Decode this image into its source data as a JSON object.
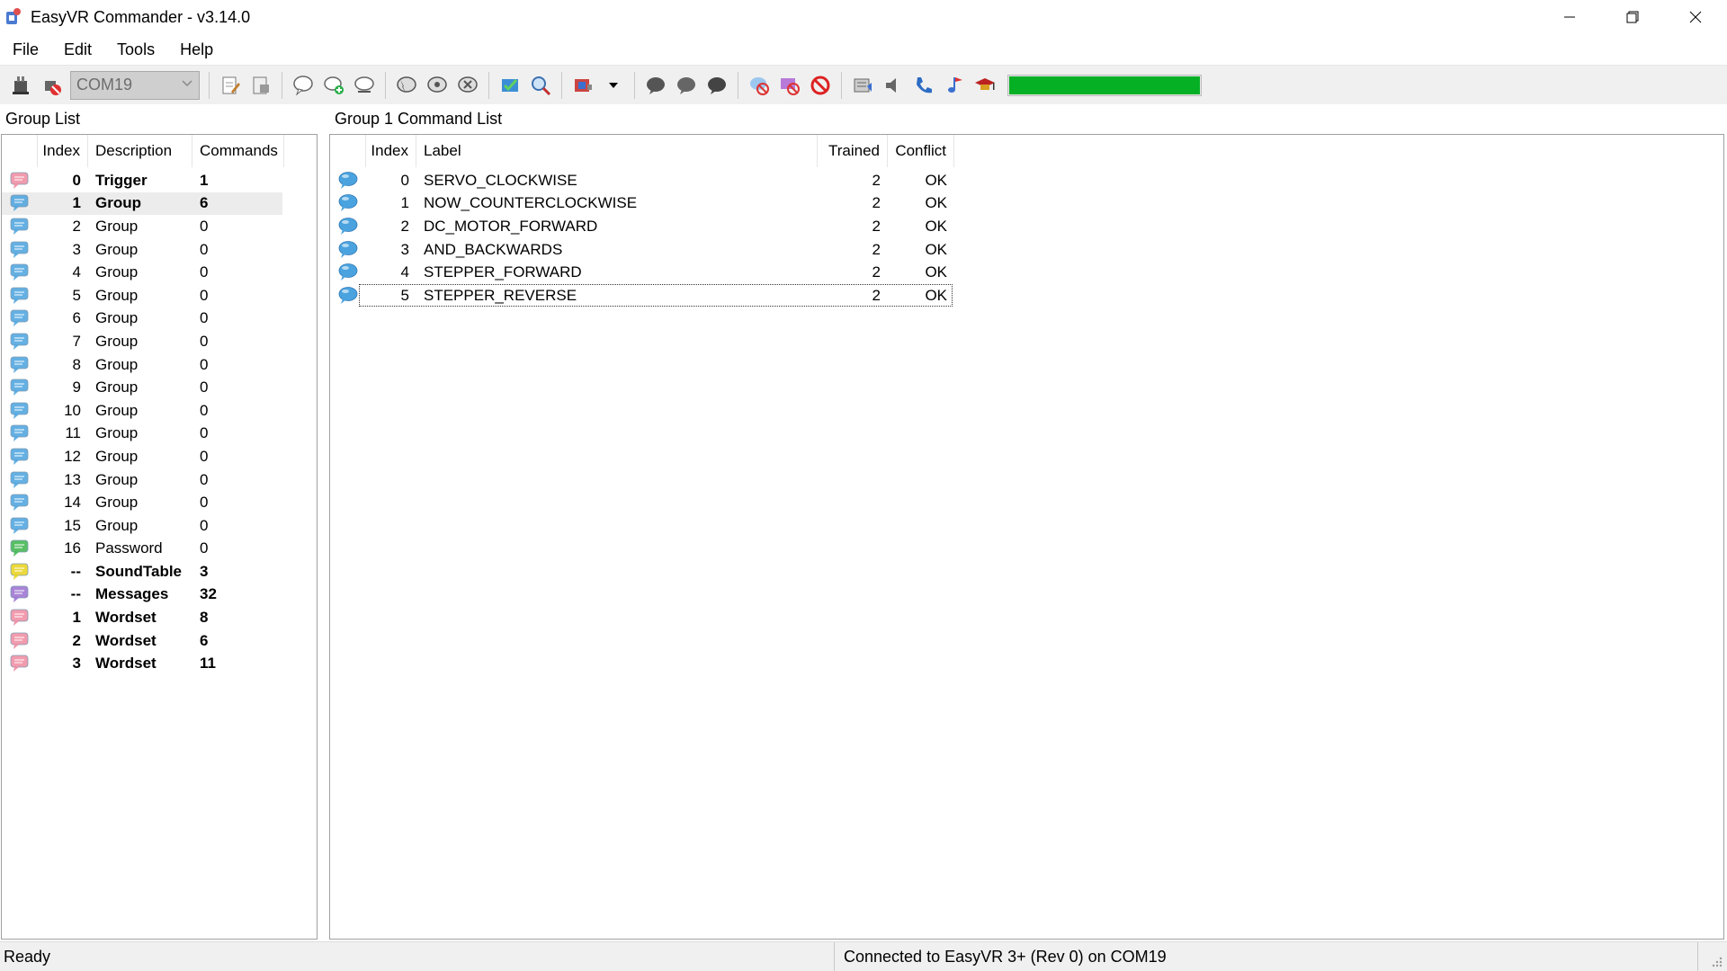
{
  "window": {
    "title": "EasyVR Commander - v3.14.0"
  },
  "menu": {
    "items": [
      "File",
      "Edit",
      "Tools",
      "Help"
    ]
  },
  "toolbar": {
    "port_value": "COM19",
    "progress": 1.0,
    "progress_color": "#06b025"
  },
  "group_panel": {
    "title": "Group List",
    "headers": {
      "index": "Index",
      "description": "Description",
      "commands": "Commands"
    },
    "rows": [
      {
        "icon": "speech-bubble-pink",
        "index": "0",
        "description": "Trigger",
        "commands": "1",
        "bold": true
      },
      {
        "icon": "speech-bubble-blue",
        "index": "1",
        "description": "Group",
        "commands": "6",
        "bold": true,
        "selected": true
      },
      {
        "icon": "speech-bubble-blue",
        "index": "2",
        "description": "Group",
        "commands": "0"
      },
      {
        "icon": "speech-bubble-blue",
        "index": "3",
        "description": "Group",
        "commands": "0"
      },
      {
        "icon": "speech-bubble-blue",
        "index": "4",
        "description": "Group",
        "commands": "0"
      },
      {
        "icon": "speech-bubble-blue",
        "index": "5",
        "description": "Group",
        "commands": "0"
      },
      {
        "icon": "speech-bubble-blue",
        "index": "6",
        "description": "Group",
        "commands": "0"
      },
      {
        "icon": "speech-bubble-blue",
        "index": "7",
        "description": "Group",
        "commands": "0"
      },
      {
        "icon": "speech-bubble-blue",
        "index": "8",
        "description": "Group",
        "commands": "0"
      },
      {
        "icon": "speech-bubble-blue",
        "index": "9",
        "description": "Group",
        "commands": "0"
      },
      {
        "icon": "speech-bubble-blue",
        "index": "10",
        "description": "Group",
        "commands": "0"
      },
      {
        "icon": "speech-bubble-blue",
        "index": "11",
        "description": "Group",
        "commands": "0"
      },
      {
        "icon": "speech-bubble-blue",
        "index": "12",
        "description": "Group",
        "commands": "0"
      },
      {
        "icon": "speech-bubble-blue",
        "index": "13",
        "description": "Group",
        "commands": "0"
      },
      {
        "icon": "speech-bubble-blue",
        "index": "14",
        "description": "Group",
        "commands": "0"
      },
      {
        "icon": "speech-bubble-blue",
        "index": "15",
        "description": "Group",
        "commands": "0"
      },
      {
        "icon": "speech-bubble-green",
        "index": "16",
        "description": "Password",
        "commands": "0"
      },
      {
        "icon": "speech-bubble-yellow",
        "index": "--",
        "description": "SoundTable",
        "commands": "3",
        "bold": true
      },
      {
        "icon": "speech-bubble-purple",
        "index": "--",
        "description": "Messages",
        "commands": "32",
        "bold": true
      },
      {
        "icon": "speech-bubble-pink",
        "index": "1",
        "description": "Wordset",
        "commands": "8",
        "bold": true
      },
      {
        "icon": "speech-bubble-pink",
        "index": "2",
        "description": "Wordset",
        "commands": "6",
        "bold": true
      },
      {
        "icon": "speech-bubble-pink",
        "index": "3",
        "description": "Wordset",
        "commands": "11",
        "bold": true
      }
    ]
  },
  "command_panel": {
    "title": "Group 1 Command List",
    "headers": {
      "index": "Index",
      "label": "Label",
      "trained": "Trained",
      "conflict": "Conflict"
    },
    "rows": [
      {
        "index": "0",
        "label": "SERVO_CLOCKWISE",
        "trained": "2",
        "conflict": "OK"
      },
      {
        "index": "1",
        "label": "NOW_COUNTERCLOCKWISE",
        "trained": "2",
        "conflict": "OK"
      },
      {
        "index": "2",
        "label": "DC_MOTOR_FORWARD",
        "trained": "2",
        "conflict": "OK"
      },
      {
        "index": "3",
        "label": "AND_BACKWARDS",
        "trained": "2",
        "conflict": "OK"
      },
      {
        "index": "4",
        "label": "STEPPER_FORWARD",
        "trained": "2",
        "conflict": "OK"
      },
      {
        "index": "5",
        "label": "STEPPER_REVERSE",
        "trained": "2",
        "conflict": "OK",
        "focused": true
      }
    ]
  },
  "status": {
    "left": "Ready",
    "right": "Connected to EasyVR 3+ (Rev 0) on COM19"
  },
  "colors": {
    "bubble_blue": "#4aa3df",
    "bubble_pink": "#f08aa0",
    "bubble_green": "#3cb54a",
    "bubble_yellow": "#e8d21a",
    "bubble_purple": "#9b6fd0"
  }
}
